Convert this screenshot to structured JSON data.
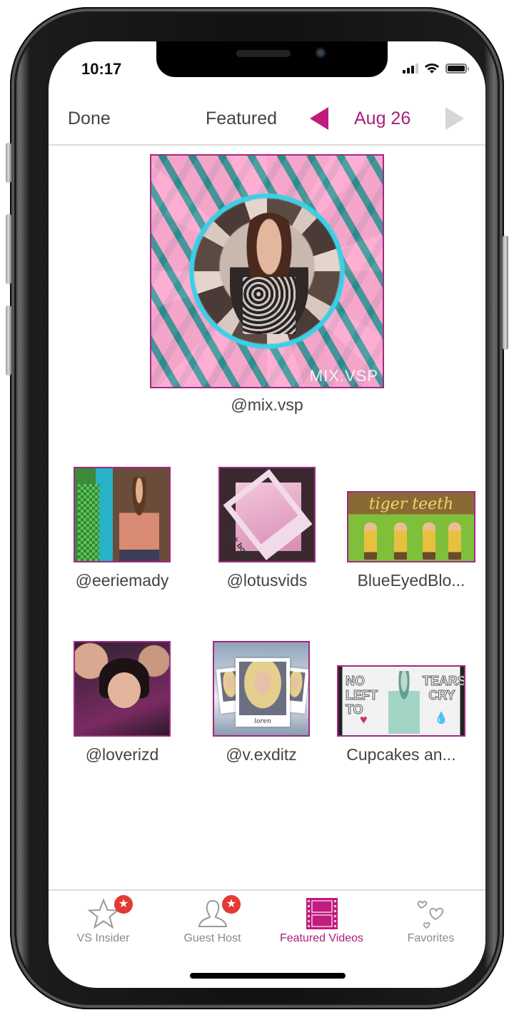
{
  "status_bar": {
    "time": "10:17",
    "signal_bars_active": 3,
    "signal_bars_total": 4,
    "wifi": "wifi-icon",
    "battery_level": 1.0
  },
  "navbar": {
    "done_label": "Done",
    "title": "Featured",
    "date": "Aug 26",
    "prev_icon": "triangle-left-icon",
    "next_icon": "triangle-right-icon",
    "prev_enabled": true,
    "next_enabled": false,
    "accent_color": "#c11b7e"
  },
  "featured": {
    "caption": "@mix.vsp",
    "watermark": "MIX.VSP"
  },
  "videos": [
    {
      "caption": "@eeriemady"
    },
    {
      "caption": "@lotusvids",
      "thumb_text": "rock bottom"
    },
    {
      "caption": "BlueEyedBlo...",
      "thumb_text": "tiger teeth"
    },
    {
      "caption": "@loverizd"
    },
    {
      "caption": "@v.exditz",
      "thumb_text": "loren"
    },
    {
      "caption": "Cupcakes an...",
      "thumb_text_left": "NO LEFT TO",
      "thumb_text_right": "TEARS CRY"
    }
  ],
  "tabbar": {
    "tabs": [
      {
        "label": "VS Insider",
        "icon": "star-outline-icon",
        "badge": "★",
        "active": false
      },
      {
        "label": "Guest Host",
        "icon": "person-outline-icon",
        "badge": "★",
        "active": false
      },
      {
        "label": "Featured Videos",
        "icon": "film-strip-icon",
        "active": true
      },
      {
        "label": "Favorites",
        "icon": "hearts-icon",
        "active": false
      }
    ],
    "active_color": "#a82077",
    "badge_color": "#e23a36"
  }
}
